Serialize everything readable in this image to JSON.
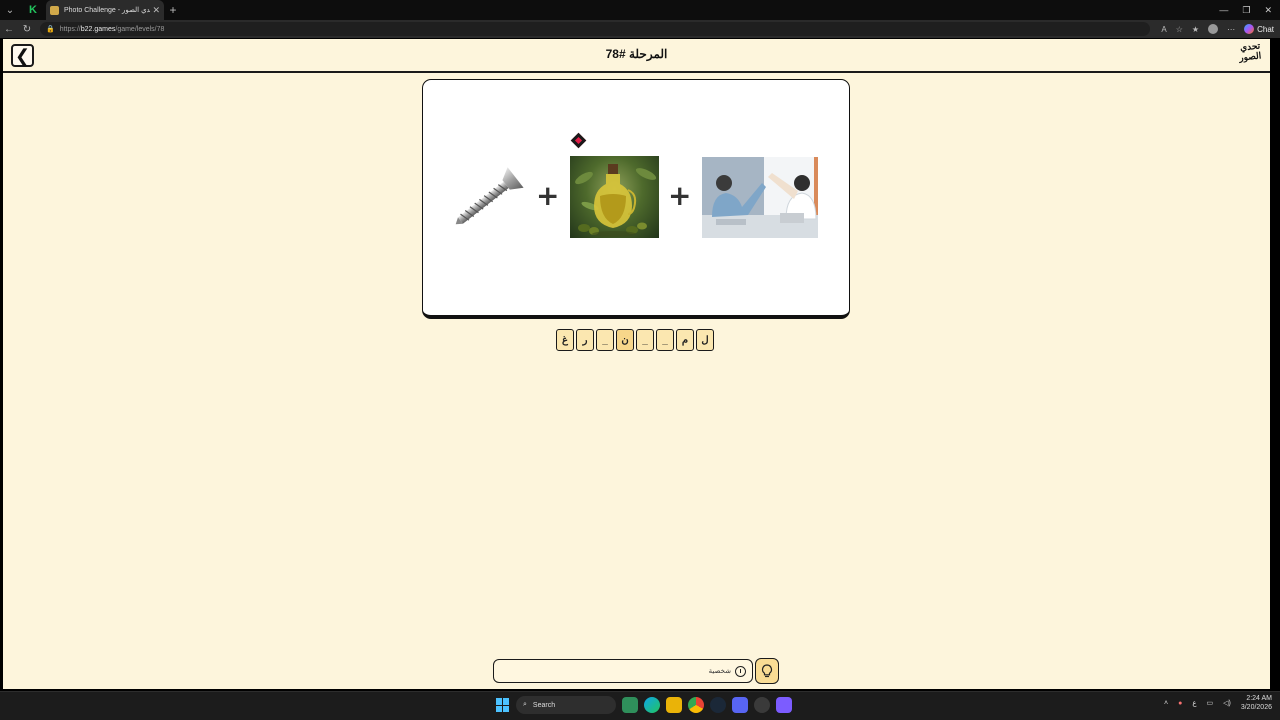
{
  "browser": {
    "tab_title": "Photo Challenge - لعبة تحدي الصور",
    "tab_close": "✕",
    "new_tab": "+",
    "url_prefix": "https://",
    "url_domain": "b22.games",
    "url_path": "/game/levels/78",
    "copilot_label": "Chat"
  },
  "header": {
    "back_glyph": "❮",
    "level_title": "المرحلة #78",
    "logo_line1": "تحدي",
    "logo_line2": "الصور"
  },
  "puzzle": {
    "images": [
      "screw-icon",
      "olive-oil-icon",
      "office-highfive-icon"
    ],
    "plus_glyph": "+"
  },
  "answer_tiles": [
    "ل",
    "م",
    "_",
    "_",
    "ن",
    "_",
    "ر",
    "غ"
  ],
  "hint": {
    "text": "شخصية"
  },
  "taskbar": {
    "search_label": "Search",
    "time": "2:24 AM",
    "date": "3/20/2026",
    "lang": "ع"
  },
  "colors": {
    "page_bg": "#fdf5dc",
    "tile_bg": "#fbe7b0",
    "tile_highlight": "#f7d68a",
    "hint_button_bg": "#f9dc94",
    "marker": "#e11d48"
  }
}
